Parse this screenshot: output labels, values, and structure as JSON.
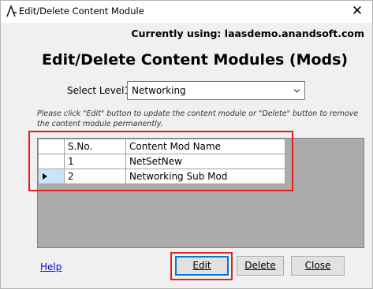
{
  "window": {
    "title": "Edit/Delete Content Module",
    "close_glyph": "✕"
  },
  "header": {
    "currently_using": "Currently using: laasdemo.anandsoft.com",
    "page_title": "Edit/Delete Content Modules (Mods)"
  },
  "level_select": {
    "label": "Select Level1:",
    "value": "Networking"
  },
  "instructions": "Please click \"Edit\" button to update the content module  or  \"Delete\" button to remove the content module permanently.",
  "grid": {
    "columns": [
      "S.No.",
      "Content Mod Name"
    ],
    "rows": [
      {
        "sno": "1",
        "name": "NetSetNew",
        "selected": false
      },
      {
        "sno": "2",
        "name": "Networking Sub Mod",
        "selected": true
      }
    ]
  },
  "footer": {
    "help_label": "Help",
    "edit_label": "Edit",
    "delete_label": "Delete",
    "close_label": "Close"
  },
  "colors": {
    "highlight": "#e0201f",
    "selection": "#cce4f7",
    "link": "#0000ee"
  }
}
